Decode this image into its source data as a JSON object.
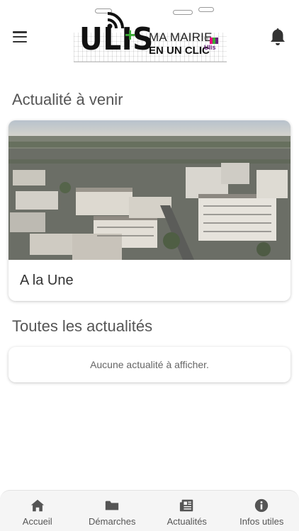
{
  "header": {
    "logo": {
      "brand": "ULIS",
      "plus": "+",
      "line1": "MA MAIRIE",
      "line2": "EN UN CLIC",
      "badge_les": "les",
      "badge_name": "Ulis"
    }
  },
  "sections": {
    "upcoming_title": "Actualité à venir",
    "featured_card_title": "A la Une",
    "all_title": "Toutes les actualités",
    "empty_message": "Aucune actualité à afficher."
  },
  "tabbar": {
    "tabs": [
      {
        "label": "Accueil",
        "icon": "home-icon"
      },
      {
        "label": "Démarches",
        "icon": "folder-icon"
      },
      {
        "label": "Actualités",
        "icon": "newspaper-icon"
      },
      {
        "label": "Infos utiles",
        "icon": "info-icon"
      }
    ]
  },
  "colors": {
    "logo_green": "#3aaa35",
    "logo_pink": "#e5007e",
    "icon_gray": "#555555"
  }
}
